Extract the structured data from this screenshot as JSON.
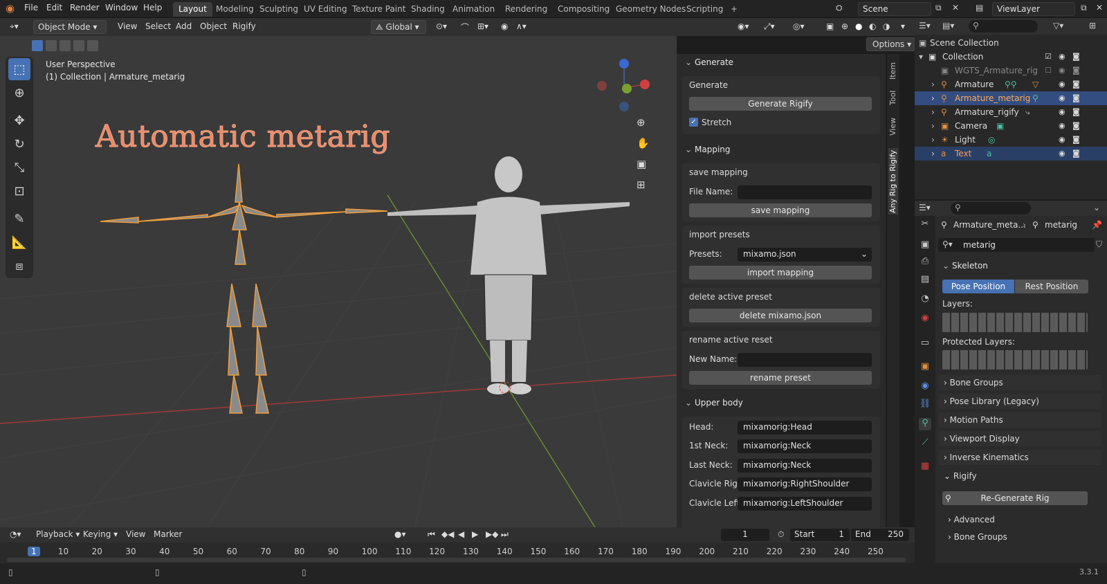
{
  "topbar": {
    "menus": [
      "File",
      "Edit",
      "Render",
      "Window",
      "Help"
    ],
    "workspaces": [
      "Layout",
      "Modeling",
      "Sculpting",
      "UV Editing",
      "Texture Paint",
      "Shading",
      "Animation",
      "Rendering",
      "Compositing",
      "Geometry Nodes",
      "Scripting",
      "+"
    ],
    "scene": "Scene",
    "view_layer": "ViewLayer"
  },
  "header3d": {
    "mode": "Object Mode",
    "menus": [
      "View",
      "Select",
      "Add",
      "Object",
      "Rigify"
    ],
    "orientation": "Global",
    "options": "Options"
  },
  "viewport": {
    "perspective": "User Perspective",
    "collection": "(1) Collection | Armature_metarig",
    "title_text": "Automatic metarig"
  },
  "npanel_tabs": [
    "Item",
    "Tool",
    "View",
    "Any Rig to Rigify"
  ],
  "npanel": {
    "generate": {
      "header": "Generate",
      "label": "Generate",
      "button": "Generate Rigify",
      "stretch": "Stretch"
    },
    "mapping": {
      "header": "Mapping",
      "save_label": "save mapping",
      "file_name_label": "File Name:",
      "file_name_value": "",
      "save_button": "save mapping",
      "import_label": "import presets",
      "presets_label": "Presets:",
      "presets_value": "mixamo.json",
      "import_button": "import mapping",
      "delete_label": "delete active preset",
      "delete_button": "delete mixamo.json",
      "rename_label": "rename active reset",
      "new_name_label": "New Name:",
      "new_name_value": "",
      "rename_button": "rename preset"
    },
    "upper_body": {
      "header": "Upper body",
      "rows": [
        {
          "label": "Head:",
          "value": "mixamorig:Head"
        },
        {
          "label": "1st Neck:",
          "value": "mixamorig:Neck"
        },
        {
          "label": "Last Neck:",
          "value": "mixamorig:Neck"
        },
        {
          "label": "Clavicle Right",
          "value": "mixamorig:RightShoulder"
        },
        {
          "label": "Clavicle Left:",
          "value": "mixamorig:LeftShoulder"
        }
      ]
    }
  },
  "outliner": {
    "scene_collection": "Scene Collection",
    "items": [
      {
        "name": "Collection"
      },
      {
        "name": "WGTS_Armature_rig"
      },
      {
        "name": "Armature"
      },
      {
        "name": "Armature_metarig"
      },
      {
        "name": "Armature_rigify"
      },
      {
        "name": "Camera"
      },
      {
        "name": "Light"
      },
      {
        "name": "Text"
      }
    ]
  },
  "properties": {
    "breadcrumb_obj": "Armature_meta...",
    "breadcrumb_data": "metarig",
    "datablock": "metarig",
    "skeleton": "Skeleton",
    "pose_position": "Pose Position",
    "rest_position": "Rest Position",
    "layers": "Layers:",
    "protected_layers": "Protected Layers:",
    "sections": [
      "Bone Groups",
      "Pose Library (Legacy)",
      "Motion Paths",
      "Viewport Display",
      "Inverse Kinematics",
      "Rigify"
    ],
    "regen": "Re-Generate Rig",
    "sub": [
      "Advanced",
      "Bone Groups"
    ]
  },
  "timeline": {
    "menus": [
      "Playback",
      "Keying",
      "View",
      "Marker"
    ],
    "current": "1",
    "start_label": "Start",
    "start": "1",
    "end_label": "End",
    "end": "250",
    "ticks": [
      "1",
      "10",
      "20",
      "30",
      "40",
      "50",
      "60",
      "70",
      "80",
      "90",
      "100",
      "110",
      "120",
      "130",
      "140",
      "150",
      "160",
      "170",
      "180",
      "190",
      "200",
      "210",
      "220",
      "230",
      "240",
      "250"
    ]
  },
  "status": {
    "version": "3.3.1"
  }
}
